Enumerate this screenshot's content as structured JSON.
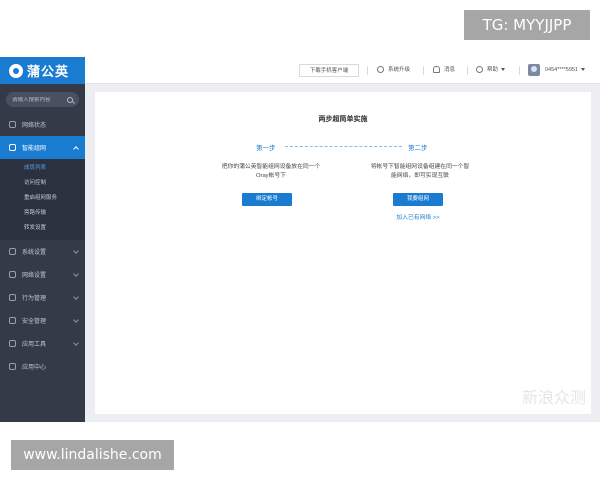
{
  "watermark_tag": "TG: MYYJJPP",
  "url_tag": "www.lindalishe.com",
  "corner_mark": "新浪众测",
  "sidebar": {
    "brand": "蒲公英",
    "search_placeholder": "请输入搜索内容",
    "items": [
      {
        "label": "网络状态",
        "icon": "status-icon"
      },
      {
        "label": "智能组网",
        "icon": "network-icon",
        "active": true
      },
      {
        "label": "系统设置",
        "icon": "settings-icon"
      },
      {
        "label": "网络设置",
        "icon": "globe-icon"
      },
      {
        "label": "行为管理",
        "icon": "behavior-icon"
      },
      {
        "label": "安全管理",
        "icon": "shield-icon"
      },
      {
        "label": "应用工具",
        "icon": "tools-icon"
      },
      {
        "label": "应用中心",
        "icon": "apps-icon"
      }
    ],
    "subitems": [
      {
        "label": "成员列表",
        "active": true
      },
      {
        "label": "访问控制"
      },
      {
        "label": "重启组网服务"
      },
      {
        "label": "旁路传输"
      },
      {
        "label": "转发设置"
      }
    ]
  },
  "header": {
    "download_label": "下载手机客户端",
    "upgrade_label": "系统升级",
    "messages_label": "消息",
    "help_label": "帮助",
    "account_label": "0454****5951"
  },
  "card": {
    "title": "两步超简单实施",
    "step1_label": "第一步",
    "step2_label": "第二步",
    "step1_desc": "把你的蒲公英智能组网设备放在同一个Oray帐号下",
    "step2_desc": "将帐号下智能组网设备组建在同一个智能网络，即可实现互联",
    "step1_button": "绑定帐号",
    "step2_button": "我要组网",
    "join_link": "加入已有网络 >>"
  },
  "colors": {
    "brand_blue": "#1a7cd1",
    "sidebar_bg": "#353a49"
  }
}
